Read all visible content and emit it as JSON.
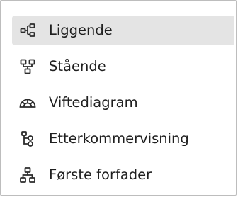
{
  "menu": {
    "items": [
      {
        "label": "Liggende",
        "icon": "horizontal-tree-icon",
        "selected": true
      },
      {
        "label": "Stående",
        "icon": "vertical-tree-icon",
        "selected": false
      },
      {
        "label": "Viftediagram",
        "icon": "fan-chart-icon",
        "selected": false
      },
      {
        "label": "Etterkommervisning",
        "icon": "descendant-tree-icon",
        "selected": false
      },
      {
        "label": "Første forfader",
        "icon": "first-ancestor-icon",
        "selected": false
      }
    ]
  },
  "colors": {
    "selected_background": "#e4e4e4",
    "text": "#1f1f1f",
    "border": "#bdbdbd"
  }
}
